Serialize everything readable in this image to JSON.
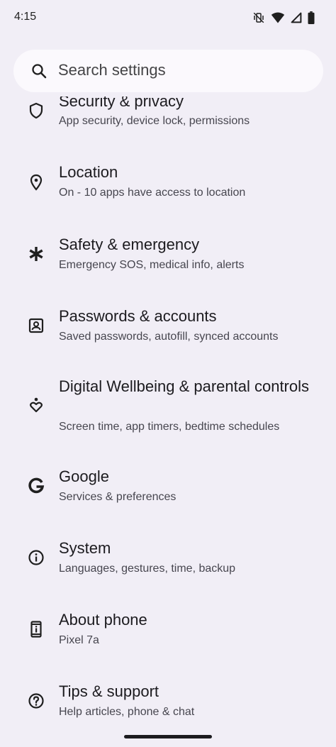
{
  "status_bar": {
    "time": "4:15",
    "icons": [
      "vibrate-off-icon",
      "wifi-icon",
      "signal-icon",
      "battery-icon"
    ]
  },
  "search": {
    "placeholder": "Search settings",
    "icon": "search-icon"
  },
  "settings": [
    {
      "id": "security",
      "title": "Security & privacy",
      "subtitle": "App security, device lock, permissions",
      "icon": "shield-icon"
    },
    {
      "id": "location",
      "title": "Location",
      "subtitle": "On - 10 apps have access to location",
      "icon": "location-pin-icon"
    },
    {
      "id": "safety",
      "title": "Safety & emergency",
      "subtitle": "Emergency SOS, medical info, alerts",
      "icon": "asterisk-icon"
    },
    {
      "id": "passwords",
      "title": "Passwords & accounts",
      "subtitle": "Saved passwords, autofill, synced accounts",
      "icon": "account-box-icon"
    },
    {
      "id": "wellbeing",
      "title": "Digital Wellbeing & parental controls",
      "subtitle": "Screen time, app timers, bedtime schedules",
      "icon": "wellbeing-heart-icon"
    },
    {
      "id": "google",
      "title": "Google",
      "subtitle": "Services & preferences",
      "icon": "google-g-icon"
    },
    {
      "id": "system",
      "title": "System",
      "subtitle": "Languages, gestures, time, backup",
      "icon": "info-icon"
    },
    {
      "id": "about",
      "title": "About phone",
      "subtitle": "Pixel 7a",
      "icon": "phone-info-icon"
    },
    {
      "id": "tips",
      "title": "Tips & support",
      "subtitle": "Help articles, phone & chat",
      "icon": "help-icon"
    }
  ]
}
